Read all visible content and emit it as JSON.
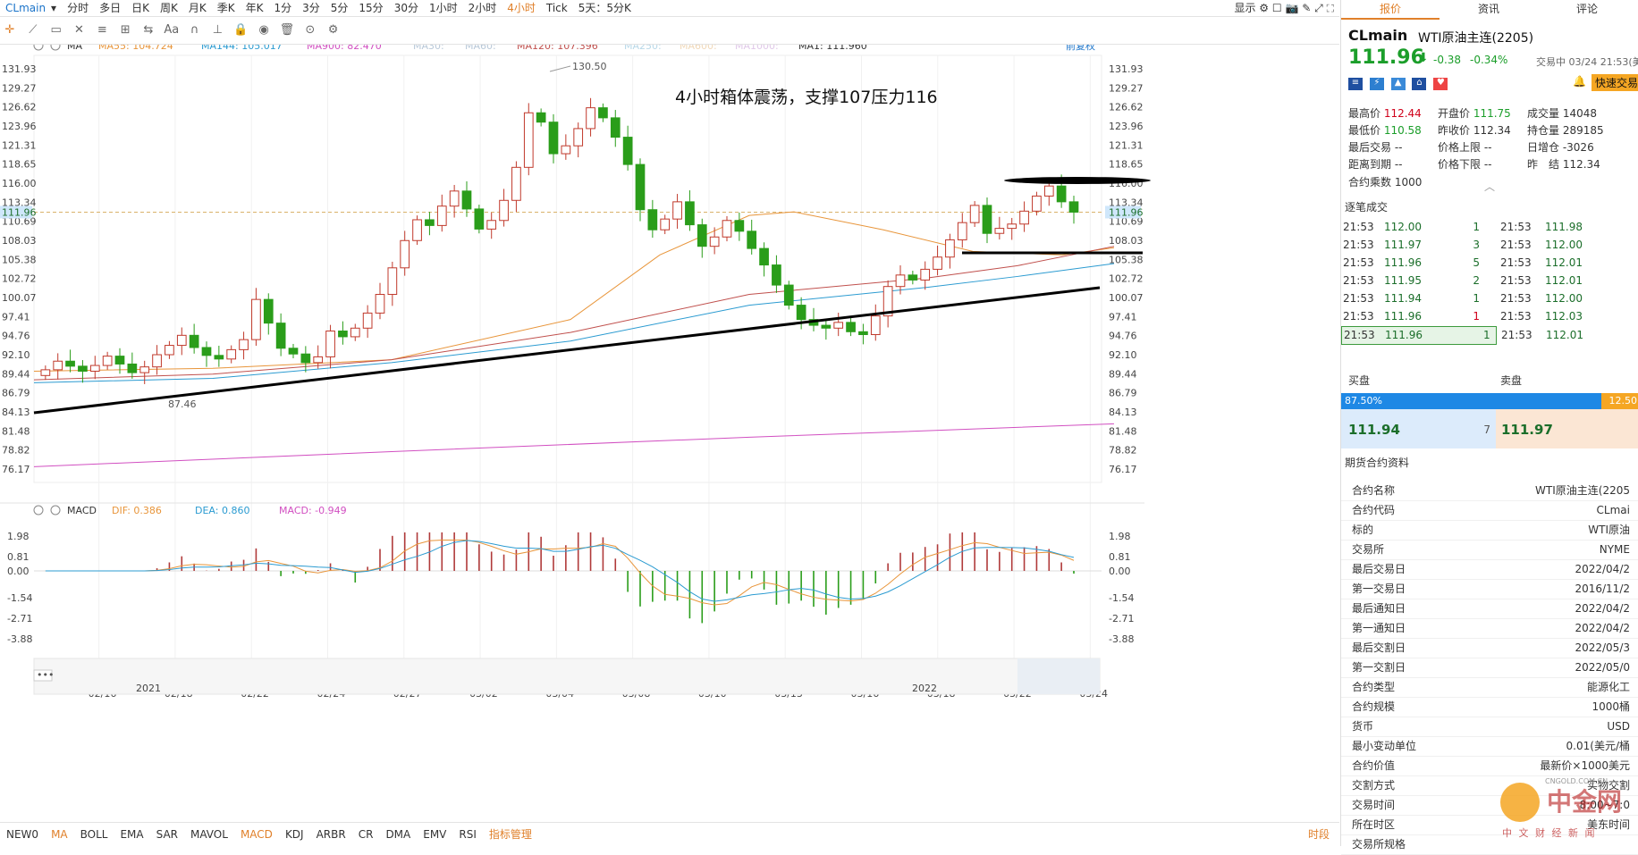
{
  "topbar": {
    "symbol": "CLmain",
    "periods": [
      "分时",
      "多日",
      "日K",
      "周K",
      "月K",
      "季K",
      "年K",
      "1分",
      "3分",
      "5分",
      "15分",
      "30分",
      "1小时",
      "2小时",
      "4小时",
      "Tick",
      "5天：5分K"
    ],
    "active_period": "4小时",
    "display_label": "显示"
  },
  "main_legend": {
    "label": "MA",
    "items": [
      {
        "text": "MA55: 104.724",
        "color": "#e8953a"
      },
      {
        "text": "MA144: 105.017",
        "color": "#2b9bd1"
      },
      {
        "text": "MA900: 82.470",
        "color": "#d14fc1"
      },
      {
        "text": "MA30:",
        "color": "#b8c8d8"
      },
      {
        "text": "MA60:",
        "color": "#b8c8d8"
      },
      {
        "text": "MA120: 107.396",
        "color": "#c0504d"
      },
      {
        "text": "MA250:",
        "color": "#b8d8e8"
      },
      {
        "text": "MA600:",
        "color": "#f0d8b8"
      },
      {
        "text": "MA1000:",
        "color": "#e0c8e8"
      },
      {
        "text": "MA1: 111.960",
        "color": "#333333"
      }
    ],
    "adjust": "前复权"
  },
  "annotation": "4小时箱体震荡，支撑107压力116",
  "macd_legend": {
    "label": "MACD",
    "items": [
      {
        "text": "DIF: 0.386",
        "color": "#e8953a"
      },
      {
        "text": "DEA: 0.860",
        "color": "#2b9bd1"
      },
      {
        "text": "MACD: -0.949",
        "color": "#d14fc1"
      }
    ]
  },
  "chart_data": [
    {
      "type": "candlestick",
      "price_axis": [
        "131.93",
        "129.27",
        "126.62",
        "123.96",
        "121.31",
        "118.65",
        "116.00",
        "113.34",
        "110.69",
        "108.03",
        "105.38",
        "102.72",
        "100.07",
        "97.41",
        "94.76",
        "92.10",
        "89.44",
        "86.79",
        "84.13",
        "81.48",
        "78.82",
        "76.17"
      ],
      "ylim": [
        76.17,
        131.93
      ],
      "x_labels": [
        "02/16",
        "02/18",
        "02/22",
        "02/24",
        "02/27",
        "03/02",
        "03/04",
        "03/08",
        "03/10",
        "03/13",
        "03/16",
        "03/18",
        "03/22",
        "03/24"
      ],
      "last_price": "111.96",
      "annotations": {
        "high": "130.50",
        "low": "87.46"
      },
      "close_series": [
        90.0,
        91.2,
        90.5,
        89.8,
        90.6,
        91.9,
        90.8,
        89.6,
        90.4,
        92.1,
        93.4,
        94.8,
        93.1,
        92.0,
        91.5,
        92.8,
        94.2,
        99.8,
        96.5,
        93.0,
        92.2,
        91.0,
        91.8,
        95.4,
        94.6,
        95.8,
        97.9,
        100.5,
        104.2,
        108.0,
        110.9,
        110.1,
        112.8,
        114.9,
        112.4,
        109.6,
        110.8,
        113.6,
        118.2,
        125.8,
        124.5,
        120.1,
        121.2,
        123.6,
        126.5,
        125.1,
        122.4,
        118.6,
        112.3,
        109.5,
        111.0,
        113.4,
        110.2,
        107.2,
        108.5,
        110.8,
        109.3,
        106.9,
        104.6,
        101.8,
        99.0,
        97.0,
        96.2,
        95.8,
        96.6,
        95.3,
        94.9,
        97.5,
        101.6,
        103.2,
        102.5,
        104.0,
        105.7,
        108.1,
        110.5,
        112.9,
        109.0,
        109.7,
        110.3,
        112.1,
        114.2,
        115.6,
        113.4,
        111.96
      ],
      "ma": [
        {
          "name": "MA55",
          "color": "#e8953a",
          "values": [
            [
              0,
              89.8
            ],
            [
              200,
              90.2
            ],
            [
              400,
              91.4
            ],
            [
              600,
              97.0
            ],
            [
              700,
              106.0
            ],
            [
              800,
              111.5
            ],
            [
              850,
              112.0
            ],
            [
              950,
              109.5
            ],
            [
              1050,
              106.5
            ],
            [
              1150,
              106.0
            ],
            [
              1208,
              107.0
            ]
          ]
        },
        {
          "name": "MA144",
          "color": "#2b9bd1",
          "values": [
            [
              0,
              88.2
            ],
            [
              200,
              88.8
            ],
            [
              400,
              91.0
            ],
            [
              600,
              94.0
            ],
            [
              800,
              99.0
            ],
            [
              1000,
              101.5
            ],
            [
              1100,
              103.0
            ],
            [
              1208,
              104.8
            ]
          ]
        },
        {
          "name": "MA120",
          "color": "#c0504d",
          "values": [
            [
              0,
              88.6
            ],
            [
              200,
              89.4
            ],
            [
              400,
              91.4
            ],
            [
              600,
              95.2
            ],
            [
              800,
              100.5
            ],
            [
              1000,
              102.8
            ],
            [
              1100,
              104.5
            ],
            [
              1208,
              107.2
            ]
          ]
        },
        {
          "name": "MA900",
          "color": "#d14fc1",
          "values": [
            [
              0,
              76.5
            ],
            [
              400,
              78.6
            ],
            [
              800,
              80.6
            ],
            [
              1208,
              82.47
            ]
          ]
        }
      ]
    },
    {
      "type": "bar",
      "name": "MACD",
      "axis": [
        "1.98",
        "0.81",
        "0.00",
        "-1.54",
        "-2.71",
        "-3.88"
      ],
      "ylim": [
        -3.88,
        2.5
      ]
    }
  ],
  "scroll": {
    "left_label": "2021",
    "right_label": "2022"
  },
  "bottom_tabs": [
    "NEW0",
    "MA",
    "BOLL",
    "EMA",
    "SAR",
    "MAVOL",
    "MACD",
    "KDJ",
    "ARBR",
    "CR",
    "DMA",
    "EMV",
    "RSI",
    "指标管理"
  ],
  "bottom_active": [
    "MA",
    "MACD"
  ],
  "bottom_right": "时段",
  "panel": {
    "tabs": [
      "报价",
      "资讯",
      "评论"
    ],
    "code": "CLmain",
    "name": "WTI原油主连(2205)",
    "price": "111.96",
    "change": "-0.38",
    "change_pct": "-0.34%",
    "status": "交易中 03/24 21:53(美",
    "quick_trade": "快速交易",
    "stats": [
      [
        "最高价",
        "112.44",
        "red"
      ],
      [
        "开盘价",
        "111.75",
        "green"
      ],
      [
        "成交量",
        "14048",
        ""
      ],
      [
        "最低价",
        "110.58",
        "green"
      ],
      [
        "昨收价",
        "112.34",
        ""
      ],
      [
        "持仓量",
        "289185",
        ""
      ],
      [
        "最后交易",
        "--",
        ""
      ],
      [
        "价格上限",
        "--",
        ""
      ],
      [
        "日增仓",
        "-3026",
        ""
      ],
      [
        "距离到期",
        "--",
        ""
      ],
      [
        "价格下限",
        "--",
        ""
      ],
      [
        "昨　结",
        "112.34",
        ""
      ],
      [
        "合约乘数",
        "1000",
        ""
      ]
    ],
    "ticks_title": "逐笔成交",
    "ticks": [
      [
        "21:53",
        "112.00",
        "1",
        "21:53",
        "111.98"
      ],
      [
        "21:53",
        "111.97",
        "3",
        "21:53",
        "112.00"
      ],
      [
        "21:53",
        "111.96",
        "5",
        "21:53",
        "112.01"
      ],
      [
        "21:53",
        "111.95",
        "2",
        "21:53",
        "112.01"
      ],
      [
        "21:53",
        "111.94",
        "1",
        "21:53",
        "112.00"
      ],
      [
        "21:53",
        "111.96",
        "1",
        "21:53",
        "112.03"
      ],
      [
        "21:53",
        "111.96",
        "1",
        "21:53",
        "112.01"
      ]
    ],
    "bid_label": "买盘",
    "ask_label": "卖盘",
    "bid_pct": "87.50%",
    "ask_pct": "12.50",
    "bid_pct_value": 0.875,
    "bid_price": "111.94",
    "bid_qty": "7",
    "ask_price": "111.97",
    "info_title": "期货合约资料",
    "info": [
      [
        "合约名称",
        "WTI原油主连(2205"
      ],
      [
        "合约代码",
        "CLmai"
      ],
      [
        "标的",
        "WTI原油"
      ],
      [
        "交易所",
        "NYME"
      ],
      [
        "最后交易日",
        "2022/04/2"
      ],
      [
        "第一交易日",
        "2016/11/2"
      ],
      [
        "最后通知日",
        "2022/04/2"
      ],
      [
        "第一通知日",
        "2022/04/2"
      ],
      [
        "最后交割日",
        "2022/05/3"
      ],
      [
        "第一交割日",
        "2022/05/0"
      ],
      [
        "合约类型",
        "能源化工"
      ],
      [
        "合约规模",
        "1000桶"
      ],
      [
        "货币",
        "USD"
      ],
      [
        "最小变动单位",
        "0.01(美元/桶"
      ],
      [
        "合约价值",
        "最新价×1000美元"
      ],
      [
        "交割方式",
        "实物交割"
      ],
      [
        "交易时间",
        "8:00~7:0"
      ],
      [
        "所在时区",
        "美东时间"
      ],
      [
        "交易所规格",
        ""
      ]
    ],
    "watermark": "中金网",
    "watermark_sub": "中 文 财 经 新 闻",
    "watermark_url": "CNGOLD.COM.CN"
  }
}
